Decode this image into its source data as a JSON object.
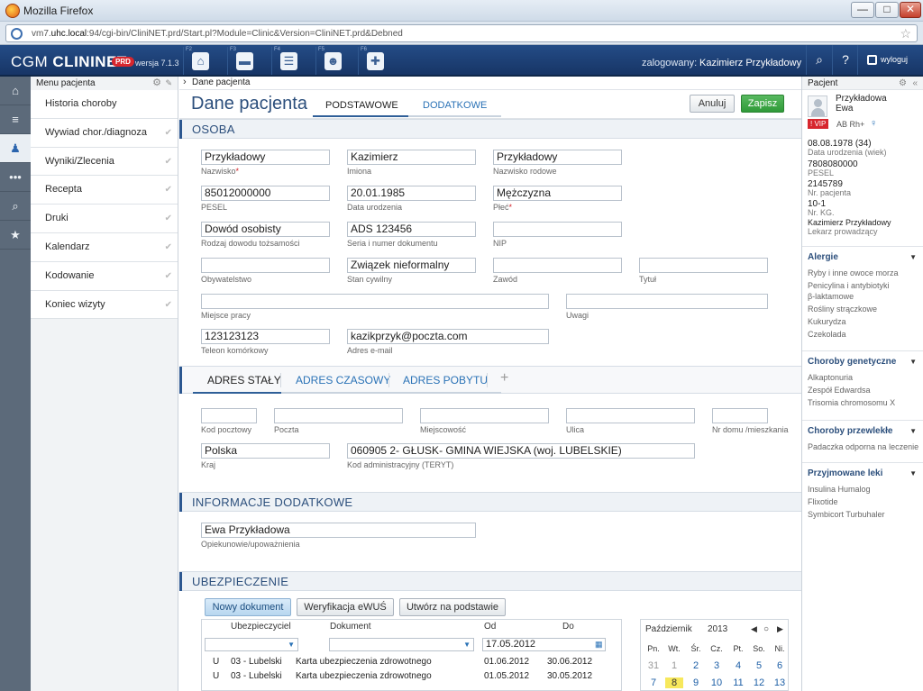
{
  "browser": {
    "title": "Mozilla Firefox",
    "url_prefix": "vm7.",
    "url_host": "uhc.local",
    "url_rest": ":94/cgi-bin/CliniNET.prd/Start.pl?Module=Clinic&Version=CliniNET.prd&Debned",
    "min": "—",
    "max": "□",
    "close": "✕"
  },
  "app": {
    "brand_cgm": "CGM",
    "brand_name": "CLININET",
    "prd": "PRD",
    "version": "wersja 7.1.3",
    "toolbar": [
      {
        "fn": "F2",
        "icon": "home-icon",
        "glyph": "⌂"
      },
      {
        "fn": "F3",
        "icon": "bed-icon",
        "glyph": "▬"
      },
      {
        "fn": "F4",
        "icon": "clipboard-icon",
        "glyph": "☰"
      },
      {
        "fn": "F5",
        "icon": "doctor-icon",
        "glyph": "☻"
      },
      {
        "fn": "F6",
        "icon": "ambulance-icon",
        "glyph": "✚"
      }
    ],
    "logged_label": "zalogowany:",
    "logged_user": "Kazimierz Przykładowy",
    "search_glyph": "⌕",
    "help_glyph": "?",
    "logout": "wyloguj"
  },
  "leftnav": [
    {
      "name": "home-icon",
      "glyph": "⌂"
    },
    {
      "name": "list-icon",
      "glyph": "≡"
    },
    {
      "name": "patient-icon",
      "glyph": "♟"
    },
    {
      "name": "more-icon",
      "glyph": "•••"
    },
    {
      "name": "search-icon",
      "glyph": "⌕"
    },
    {
      "name": "star-icon",
      "glyph": "★"
    }
  ],
  "menu": {
    "title": "Menu pacjenta",
    "items": [
      "Historia choroby",
      "Wywiad chor./diagnoza",
      "Wyniki/Zlecenia",
      "Recepta",
      "Druki",
      "Kalendarz",
      "Kodowanie",
      "Koniec wizyty"
    ]
  },
  "main": {
    "breadcrumb": "Dane pacjenta",
    "title": "Dane pacjenta",
    "tab_basic": "PODSTAWOWE",
    "tab_extra": "DODATKOWE",
    "cancel": "Anuluj",
    "save": "Zapisz",
    "sec_person": "OSOBA",
    "fields": {
      "nazwisko": {
        "value": "Przykładowy",
        "label": "Nazwisko"
      },
      "imiona": {
        "value": "Kazimierz",
        "label": "Imiona"
      },
      "nazwisko_rodowe": {
        "value": "Przykładowy",
        "label": "Nazwisko rodowe"
      },
      "pesel": {
        "value": "85012000000",
        "label": "PESEL"
      },
      "data_urodzenia": {
        "value": "20.01.1985",
        "label": "Data urodzenia"
      },
      "plec": {
        "value": "Mężczyzna",
        "label": "Płeć"
      },
      "dowod": {
        "value": "Dowód osobisty",
        "label": "Rodzaj dowodu tożsamości"
      },
      "seria": {
        "value": "ADS 123456",
        "label": "Seria i numer dokumentu"
      },
      "nip": {
        "value": "",
        "label": "NIP"
      },
      "obywatelstwo": {
        "value": "",
        "label": "Obywatelstwo"
      },
      "stan": {
        "value": "Związek nieformalny",
        "label": "Stan cywilny"
      },
      "zawod": {
        "value": "",
        "label": "Zawód"
      },
      "tytul": {
        "value": "",
        "label": "Tytuł"
      },
      "miejsce_pracy": {
        "value": "",
        "label": "Miejsce pracy"
      },
      "uwagi": {
        "value": "",
        "label": "Uwagi"
      },
      "telefon": {
        "value": "123123123",
        "label": "Teleon komórkowy"
      },
      "email": {
        "value": "kazikprzyk@poczta.com",
        "label": "Adres e-mail"
      }
    },
    "addr_tabs": [
      "ADRES STAŁY",
      "ADRES CZASOWY",
      "ADRES POBYTU"
    ],
    "addr_plus": "+",
    "addr": {
      "kod": {
        "value": "",
        "label": "Kod pocztowy"
      },
      "poczta": {
        "value": "",
        "label": "Poczta"
      },
      "miejscowosc": {
        "value": "",
        "label": "Miejscowość"
      },
      "ulica": {
        "value": "",
        "label": "Ulica"
      },
      "nr": {
        "value": "",
        "label": "Nr domu /mieszkania"
      },
      "kraj": {
        "value": "Polska",
        "label": "Kraj"
      },
      "teryt": {
        "value": "060905 2- GŁUSK- GMINA WIEJSKA (woj. LUBELSKIE)",
        "label": "Kod administracyjny (TERYT)"
      }
    },
    "sec_info": "INFORMACJE DODATKOWE",
    "opiekun": {
      "value": "Ewa Przykładowa",
      "label": "Opiekunowie/upoważnienia"
    },
    "sec_ins": "UBEZPIECZENIE",
    "btn_new": "Nowy dokument",
    "btn_verify": "Weryfikacja eWUŚ",
    "btn_create": "Utwórz na podstawie",
    "grid_headers": [
      "Ubezpieczyciel",
      "Dokument",
      "Od",
      "Do"
    ],
    "grid_filter_date": "17.05.2012",
    "grid_rows": [
      {
        "flag": "U",
        "ins": "03 - Lubelski",
        "doc": "Karta ubezpieczenia zdrowotnego",
        "from": "01.06.2012",
        "to": "30.06.2012"
      },
      {
        "flag": "U",
        "ins": "03 - Lubelski",
        "doc": "Karta ubezpieczenia zdrowotnego",
        "from": "01.05.2012",
        "to": "30.05.2012"
      }
    ],
    "calendar": {
      "month": "Październik",
      "year": "2013",
      "days": [
        "Pn.",
        "Wt.",
        "Śr.",
        "Cz.",
        "Pt.",
        "So.",
        "Ni."
      ],
      "row1": [
        "31",
        "1",
        "2",
        "3",
        "4",
        "5",
        "6"
      ],
      "row2": [
        "7",
        "8",
        "9",
        "10",
        "11",
        "12",
        "13"
      ]
    }
  },
  "patient": {
    "title": "Pacjent",
    "surname": "Przykładowa",
    "firstname": "Ewa",
    "vip": "VIP",
    "vip_mark": "!",
    "blood": "AB Rh+",
    "gender_glyph": "♀",
    "dob": "08.08.1978 (34)",
    "dob_label": "Data urodzenia (wiek)",
    "pesel": "7808080000",
    "pesel_label": "PESEL",
    "nr": "2145789",
    "nr_label": "Nr. pacjenta",
    "kg": "10-1",
    "kg_label": "Nr. KG.",
    "doctor": "Kazimierz Przykładowy",
    "doctor_label": "Lekarz prowadzący",
    "allergies_title": "Alergie",
    "allergies": [
      "Ryby i inne owoce morza",
      "Penicylina i antybiotyki",
      "β-laktamowe",
      "Rośliny strączkowe",
      "Kukurydza",
      "Czekolada"
    ],
    "genetic_title": "Choroby genetyczne",
    "genetic": [
      "Alkaptonuria",
      "Zespół Edwardsa",
      "Trisomia chromosomu X"
    ],
    "chronic_title": "Choroby przewlekłe",
    "chronic": [
      "Padaczka odporna na leczenie"
    ],
    "drugs_title": "Przyjmowane leki",
    "drugs": [
      "Insulina Humalog",
      "Flixotide",
      "Symbicort Turbuhaler"
    ]
  }
}
